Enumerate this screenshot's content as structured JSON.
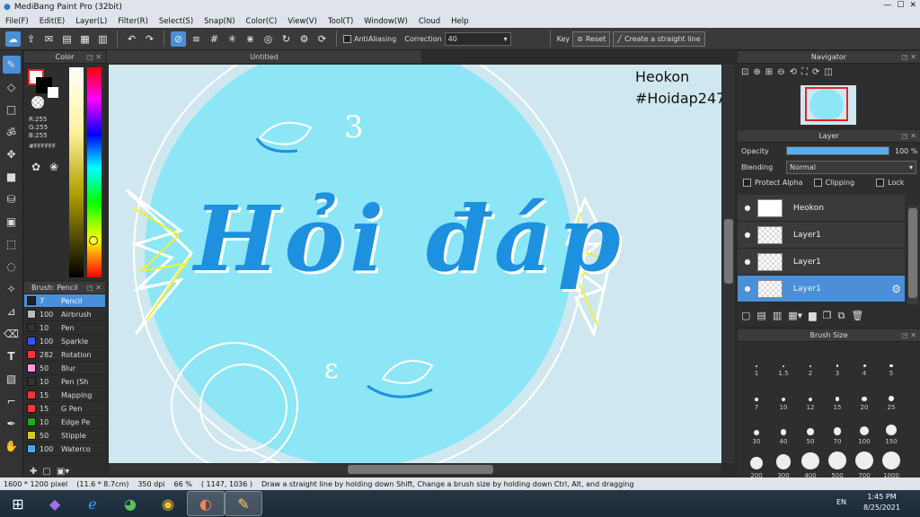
{
  "window": {
    "title": "MediBang Paint Pro (32bit)"
  },
  "menu": [
    "File(F)",
    "Edit(E)",
    "Layer(L)",
    "Filter(R)",
    "Select(S)",
    "Snap(N)",
    "Color(C)",
    "View(V)",
    "Tool(T)",
    "Window(W)",
    "Cloud",
    "Help"
  ],
  "toolbar": {
    "antialias_label": "AntiAliasing",
    "correction_label": "Correction",
    "correction_value": "40",
    "key_label": "Key",
    "reset_label": "Reset",
    "straight_line_label": "Create a straight line"
  },
  "color_panel": {
    "title": "Color",
    "r": "R:255",
    "g": "G:255",
    "b": "B:255",
    "hex": "#FFFFFF"
  },
  "brush_panel": {
    "title": "Brush: Pencil",
    "items": [
      {
        "size": "7",
        "name": "Pencil",
        "color": "#222222"
      },
      {
        "size": "100",
        "name": "Airbrush",
        "color": "#bbbbbb"
      },
      {
        "size": "10",
        "name": "Pen",
        "color": "#333333"
      },
      {
        "size": "100",
        "name": "Sparkle",
        "color": "#3355ff"
      },
      {
        "size": "282",
        "name": "Rotation",
        "color": "#ff3333"
      },
      {
        "size": "50",
        "name": "Blur",
        "color": "#ff99dd"
      },
      {
        "size": "10",
        "name": "Pen (Sh",
        "color": "#333333"
      },
      {
        "size": "15",
        "name": "Mapping",
        "color": "#ff3333"
      },
      {
        "size": "15",
        "name": "G Pen",
        "color": "#ff3333"
      },
      {
        "size": "10",
        "name": "Edge Pe",
        "color": "#22aa22"
      },
      {
        "size": "50",
        "name": "Stipple",
        "color": "#cccc22"
      },
      {
        "size": "100",
        "name": "Waterco",
        "color": "#44aaff"
      }
    ]
  },
  "document": {
    "tab": "Untitled"
  },
  "canvas_text": {
    "credit_name": "Heokon",
    "credit_tag": "#Hoidap247",
    "lettering": "Hỏi đáp",
    "num_top": "3",
    "num_bottom": "ε"
  },
  "navigator": {
    "title": "Navigator"
  },
  "layer_panel": {
    "title": "Layer",
    "opacity_label": "Opacity",
    "opacity_value": "100 %",
    "opacity": 1.0,
    "blending_label": "Blending",
    "blending_value": "Normal",
    "protect_alpha": "Protect Alpha",
    "clipping": "Clipping",
    "lock": "Lock",
    "layers": [
      {
        "name": "Heokon"
      },
      {
        "name": "Layer1"
      },
      {
        "name": "Layer1"
      },
      {
        "name": "Layer1"
      }
    ]
  },
  "brush_size": {
    "title": "Brush Size",
    "sizes": [
      "1",
      "1.5",
      "2",
      "3",
      "4",
      "5",
      "7",
      "10",
      "12",
      "15",
      "20",
      "25",
      "30",
      "40",
      "50",
      "70",
      "100",
      "150",
      "200",
      "300",
      "400",
      "500",
      "700",
      "1000"
    ]
  },
  "status": {
    "size": "1600 * 1200 pixel",
    "cm": "(11.6 * 8.7cm)",
    "dpi": "350 dpi",
    "zoom": "66 %",
    "coords": "( 1147, 1036 )",
    "hint": "Draw a straight line by holding down Shift, Change a brush size by holding down Ctrl, Alt, and dragging"
  },
  "taskbar": {
    "lang": "EN",
    "time": "1:45 PM",
    "date": "8/25/2021"
  },
  "colors": {
    "accent": "#4a90d9",
    "canvas_bg": "#cfe8ef",
    "circle": "#8de6f5",
    "lettering": "#1e90e0"
  }
}
